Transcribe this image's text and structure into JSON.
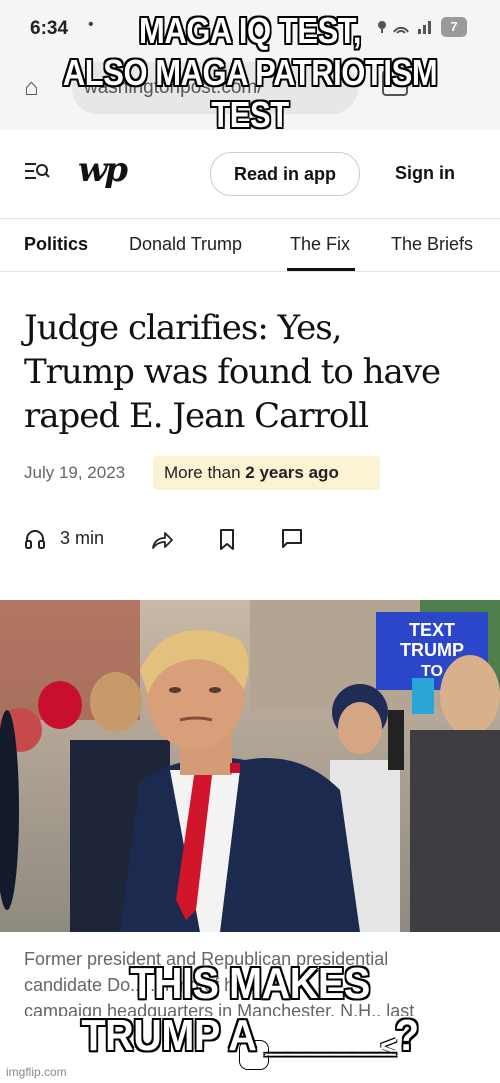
{
  "status_bar": {
    "time": "6:34",
    "dot": "•",
    "notifications": "7"
  },
  "browser": {
    "url": "washingtonpost.com/"
  },
  "meme": {
    "top_caption_line1": "MAGA IQ TEST,",
    "top_caption_line2": "ALSO MAGA PATRIOTISM TEST",
    "bottom_caption_line1": "THIS MAKES",
    "bottom_caption_line2": "TRUMP A ______?"
  },
  "header": {
    "logo": "wp",
    "read_in_app": "Read in app",
    "sign_in": "Sign in"
  },
  "nav": {
    "items": [
      "Politics",
      "Donald Trump",
      "The Fix",
      "The Briefs"
    ],
    "active": "The Fix"
  },
  "article": {
    "headline_line1": "Judge clarifies: Yes,",
    "headline_line2": "Trump was found to have",
    "headline_line3": "raped E. Jean Carroll",
    "date": "July 19, 2023",
    "ago_prefix": "More than ",
    "ago_bold": "2 years ago",
    "read_time": "3 min",
    "photo_caption_line1": "Former president and Republican presidential",
    "photo_caption_line2": "candidate Do... ...ning of his",
    "photo_caption_line3": "campaign headquarters in Manchester, N.H., last"
  },
  "photo": {
    "sign_text_1": "TEXT",
    "sign_text_2": "TRUMP",
    "sign_text_3": "TO"
  },
  "footer": {
    "watermark": "imgflip.com"
  },
  "colors": {
    "badge_bg": "#fbf3d3",
    "suit": "#1c2a4f",
    "tie": "#d1162b",
    "sign": "#2c46c9"
  },
  "icons": [
    "menu-search-icon",
    "headphones-icon",
    "share-icon",
    "bookmark-icon",
    "comment-icon",
    "tabs-icon",
    "back-arrow-icon"
  ]
}
